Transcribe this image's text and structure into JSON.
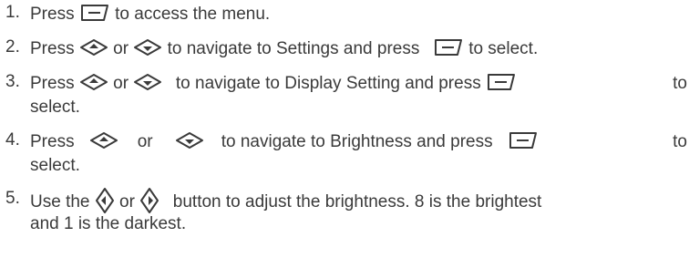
{
  "steps": [
    {
      "number": "1.",
      "t1": "Press",
      "icon1": "menu-select-key-icon",
      "t2": "to access the menu."
    },
    {
      "number": "2.",
      "t1": "Press",
      "icon1": "up-arrow-key-icon",
      "t2": "or",
      "icon2": "down-arrow-key-icon",
      "t3": "to navigate to Settings and press",
      "icon3": "menu-select-key-icon",
      "t4": "to select."
    },
    {
      "number": "3.",
      "t1": "Press",
      "icon1": "up-arrow-key-icon",
      "t2": "or",
      "icon2": "down-arrow-key-icon",
      "t3": "to navigate to Display Setting and press",
      "icon3": "menu-select-key-icon",
      "t4": "to",
      "t5": "select."
    },
    {
      "number": "4.",
      "t1": "Press",
      "icon1": "up-arrow-key-icon",
      "t2": "or",
      "icon2": "down-arrow-key-icon",
      "t3": "to navigate to Brightness and press",
      "icon3": "menu-select-key-icon",
      "t4": "to",
      "t5": "select."
    },
    {
      "number": "5.",
      "t1": "Use the",
      "icon1": "left-arrow-key-icon",
      "t2": "or",
      "icon2": "right-arrow-key-icon",
      "t3": "button to adjust the brightness. 8 is the brightest",
      "t4": "and 1 is the darkest."
    }
  ],
  "colors": {
    "text": "#3a3a3a"
  }
}
